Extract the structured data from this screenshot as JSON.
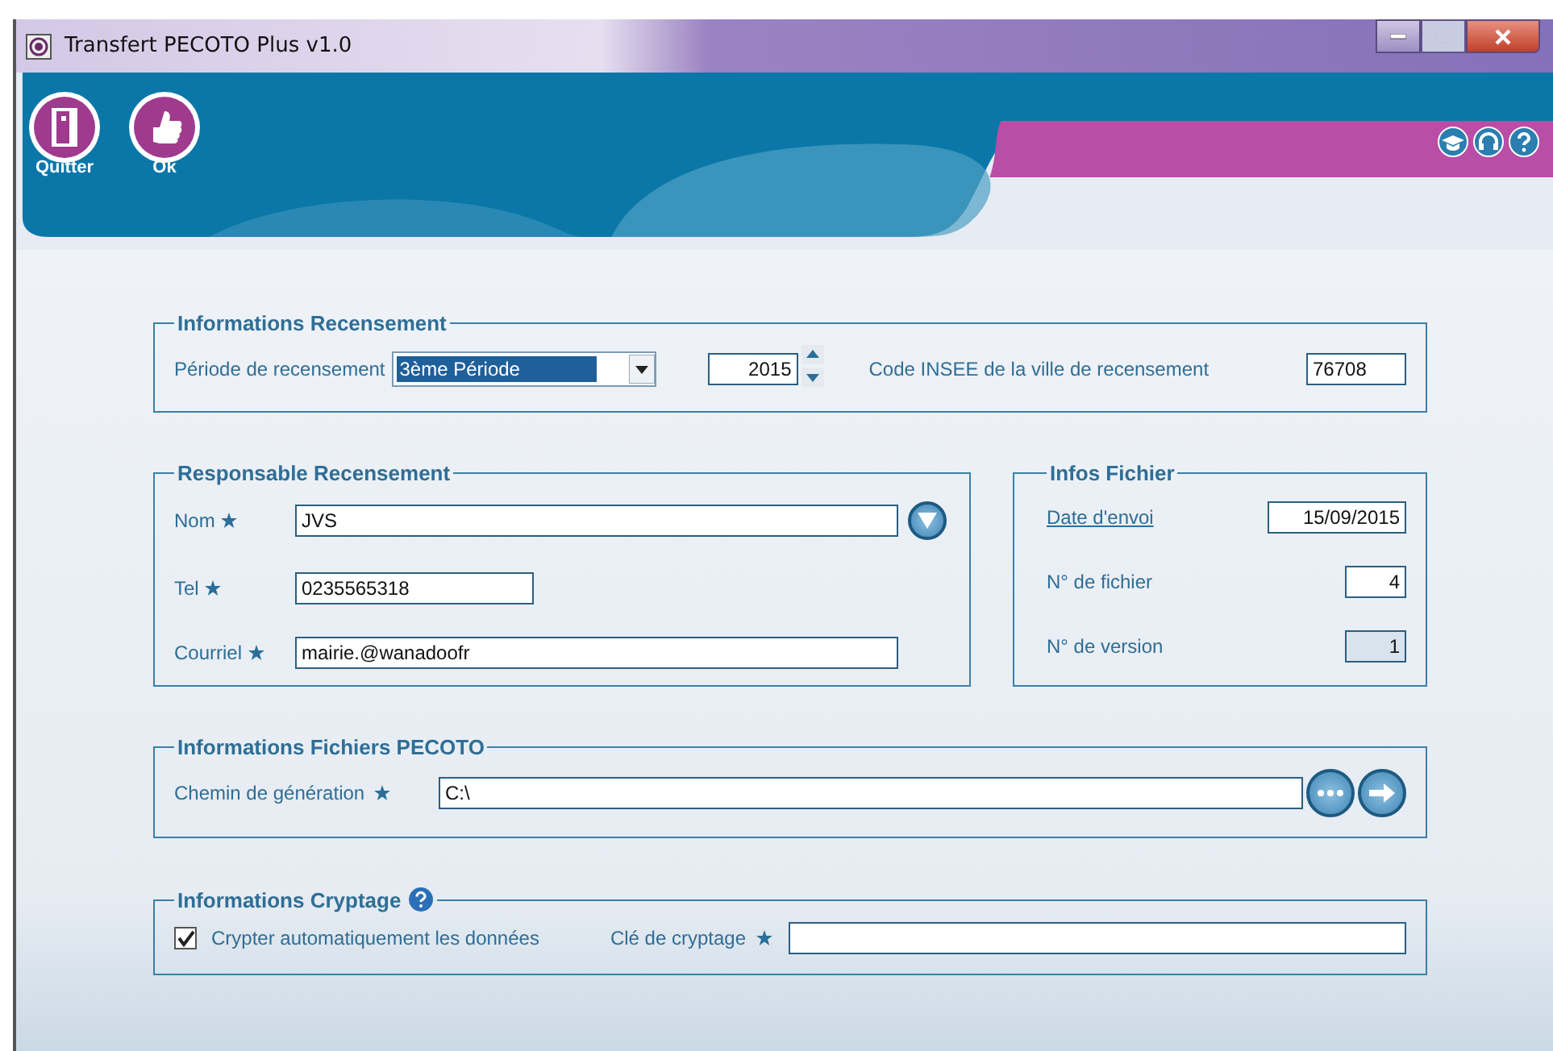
{
  "window": {
    "title": "Transfert PECOTO Plus v1.0"
  },
  "toolbar": [
    {
      "label": "Quitter",
      "kind": "door"
    },
    {
      "label": "Ok",
      "kind": "thumb"
    }
  ],
  "recensement": {
    "title": "Informations Recensement",
    "periode_label": "Période de recensement",
    "periode_value": "3ème Période",
    "year": "2015",
    "insee_label": "Code INSEE de la ville de recensement",
    "insee_value": "76708"
  },
  "responsable": {
    "title": "Responsable Recensement",
    "fields": [
      {
        "label": "Nom",
        "required": true,
        "value": "JVS",
        "kind": "wide-dropdown"
      },
      {
        "label": "Tel",
        "required": true,
        "value": "0235565318",
        "kind": "short"
      },
      {
        "label": "Courriel",
        "required": true,
        "value": "mairie.@wanadoofr",
        "kind": "wide"
      }
    ]
  },
  "infos_fichier": {
    "title": "Infos Fichier",
    "fields": [
      {
        "label": "Date d'envoi",
        "value": "15/09/2015",
        "disabled": false,
        "kind": "date"
      },
      {
        "label": "N° de fichier",
        "value": "4",
        "disabled": false,
        "kind": "number"
      },
      {
        "label": "N° de version",
        "value": "1",
        "disabled": true,
        "kind": "number"
      }
    ]
  },
  "pecoto": {
    "title": "Informations Fichiers PECOTO",
    "label": "Chemin de génération",
    "required": true,
    "value": "C:\\"
  },
  "cryptage": {
    "title": "Informations Cryptage",
    "auto_label": "Crypter automatiquement les données",
    "auto_checked": true,
    "key_label": "Clé de cryptage",
    "key_required": true
  }
}
